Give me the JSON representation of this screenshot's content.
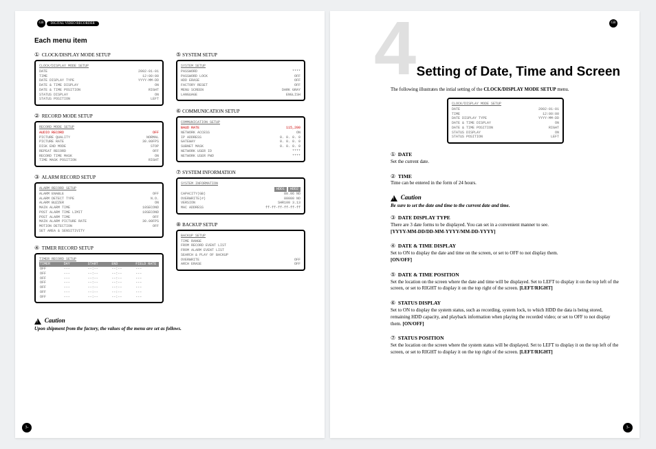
{
  "header": {
    "product": "DIGITAL VIDEO RECORDER",
    "lang": "GB"
  },
  "left": {
    "heading": "Each menu item",
    "items": [
      {
        "num": "①",
        "title": "CLOCK/DISPLAY MODE SETUP"
      },
      {
        "num": "②",
        "title": "RECORD MODE SETUP"
      },
      {
        "num": "③",
        "title": "ALARM RECORD SETUP"
      },
      {
        "num": "④",
        "title": "TIMER RECORD SETUP"
      },
      {
        "num": "⑤",
        "title": "SYSTEM SETUP"
      },
      {
        "num": "⑥",
        "title": "COMMUNICATION SETUP"
      },
      {
        "num": "⑦",
        "title": "SYSTEM INFORMATION"
      },
      {
        "num": "⑧",
        "title": "BACKUP SETUP"
      }
    ],
    "caution": {
      "label": "Caution",
      "text": "Upon shipment from the factory, the values of the menu are set as follows."
    },
    "monitors": {
      "clock": {
        "title": "CLOCK/DISPLAY MODE SETUP",
        "rows": [
          [
            "DATE",
            "2002-01-01"
          ],
          [
            "TIME",
            "12:00:00"
          ],
          [
            "DATE DISPLAY TYPE",
            "YYYY-MM-DD"
          ],
          [
            "DATE & TIME DISPLAY",
            "ON"
          ],
          [
            "DATE & TIME POSITION",
            "RIGHT"
          ],
          [
            "STATUS DISPLAY",
            "ON"
          ],
          [
            "STATUS POSITION",
            "LEFT"
          ]
        ]
      },
      "record": {
        "title": "RECORD MODE SETUP",
        "rows": [
          [
            "AUDIO RECORD",
            "OFF"
          ],
          [
            "PICTURE QUALITY",
            "NORMAL"
          ],
          [
            "PICTURE RATE",
            "30.00FPS"
          ],
          [
            "DISK END MODE",
            "STOP"
          ],
          [
            "REPEAT RECORD",
            "OFF"
          ],
          [
            "RECORD TIME MASK",
            "ON"
          ],
          [
            "TIME MASK POSITION",
            "RIGHT"
          ]
        ]
      },
      "alarm": {
        "title": "ALARM RECORD SETUP",
        "rows": [
          [
            "ALARM ENABLE",
            "OFF"
          ],
          [
            "ALARM DETECT TYPE",
            "N.O."
          ],
          [
            "ALARM BUZZER",
            "ON"
          ],
          [
            "MAIN ALARM TIME",
            "10SECOND"
          ],
          [
            "POST ALARM TIME LIMIT",
            "10SECOND"
          ],
          [
            "POST ALARM TIME",
            "OFF"
          ],
          [
            "MAIN ALARM PICTURE RATE",
            "30.00FPS"
          ],
          [
            "MOTION DETECTION",
            "OFF"
          ],
          [
            "SET AREA & SENSITIVITY",
            ""
          ]
        ]
      },
      "timer": {
        "title": "TIMER RECORD SETUP",
        "headers": [
          "TIMER",
          "DAY",
          "START",
          "END",
          "FIELD RATE"
        ],
        "rows": [
          [
            "OFF",
            "---",
            "--:--",
            "--:--",
            "---"
          ],
          [
            "OFF",
            "---",
            "--:--",
            "--:--",
            "---"
          ],
          [
            "OFF",
            "---",
            "--:--",
            "--:--",
            "---"
          ],
          [
            "OFF",
            "---",
            "--:--",
            "--:--",
            "---"
          ],
          [
            "OFF",
            "---",
            "--:--",
            "--:--",
            "---"
          ],
          [
            "OFF",
            "---",
            "--:--",
            "--:--",
            "---"
          ],
          [
            "OFF",
            "---",
            "--:--",
            "--:--",
            "---"
          ]
        ]
      },
      "system": {
        "title": "SYSTEM SETUP",
        "rows": [
          [
            "PASSWORD",
            "****"
          ],
          [
            "PASSWORD LOCK",
            "OFF"
          ],
          [
            "HDD ERASE",
            "OFF"
          ],
          [
            "FACTORY RESET",
            "OFF"
          ],
          [
            "MENU SCREEN",
            "DARK GRAY"
          ],
          [
            "LANGUAGE",
            "ENGLISH"
          ]
        ]
      },
      "comm": {
        "title": "COMMUNICATION SETUP",
        "rows": [
          [
            "BAUD RATE",
            "115,200"
          ],
          [
            "NETWORK ACCESS",
            "ON"
          ],
          [
            "IP ADDRESS",
            "0. 0. 0. 0"
          ],
          [
            "GATEWAY",
            "0. 0. 0. 0"
          ],
          [
            "SUBNET MASK",
            "0. 0. 0. 0"
          ],
          [
            "NETWORK USER ID",
            "****"
          ],
          [
            "NETWORK USER PWD",
            "****"
          ]
        ]
      },
      "sysinfo": {
        "title": "SYSTEM INFORMATION",
        "hdr": [
          "HDD1",
          "HDD2"
        ],
        "rows": [
          [
            "CAPACITY(GB)",
            "80.06  NO"
          ],
          [
            "OVERWRITE(#)",
            "00000  NO"
          ],
          [
            "VERSION",
            "SHR100 3.13"
          ],
          [
            "MAC ADDRESS",
            "ff-ff-ff-ff-ff-ff"
          ]
        ]
      },
      "backup": {
        "title": "BACKUP SETUP",
        "rows": [
          [
            "TIME RANGE",
            ""
          ],
          [
            "FROM RECORD EVENT LIST",
            ""
          ],
          [
            "FROM ALARM EVENT LIST",
            ""
          ],
          [
            "SEARCH & PLAY OF BACKUP",
            ""
          ],
          [
            "OVERWRITE",
            "OFF"
          ],
          [
            "ARCH ERASE",
            "OFF"
          ]
        ]
      }
    },
    "pagenum": "3-13"
  },
  "right": {
    "bignum": "4",
    "chapter_title": "Setting of Date, Time and Screen",
    "intro_pre": "The following illustrates the intial setting of the ",
    "intro_bold": "CLOCK/DISPLAY MODE SETUP",
    "intro_post": " menu.",
    "list": [
      {
        "num": "①",
        "title": "DATE",
        "body": "Set the current date."
      },
      {
        "num": "②",
        "title": "TIME",
        "body": "Time can be entered in the form of 24 hours."
      }
    ],
    "caution1": {
      "label": "Caution",
      "text": "Be sure to set the date and time to the current date and time."
    },
    "list2": [
      {
        "num": "③",
        "title": "DATE DISPLAY TYPE",
        "body": "There are 3 date forms to be displayed. You can set in a convenient manner to see.",
        "opt": "[YYYY-MM-DD/DD-MM-YYYY/MM-DD-YYYY]"
      },
      {
        "num": "④",
        "title": "DATE & TIME DISPLAY",
        "body": "Set to ON to display the date and time on the screen, or set to OFF to not display them.",
        "opt": "[ON/OFF]"
      },
      {
        "num": "⑤",
        "title": "DATE & TIME POSITION",
        "body": "Set the location on the screen where the date and time will be displayed. Set to LEFT to display it on the top left of the screen, or set to RIGHT to display it on the top right of the screen.",
        "opt": "[LEFT/RIGHT]"
      },
      {
        "num": "⑥",
        "title": "STATUS DISPLAY",
        "body": "Set to ON to display the system status, such as recording, system lock, to which HDD the data is being stored, remaining HDD capacity, and playback information when playing the recorded video; or set to OFF to not display them.",
        "opt": "[ON/OFF]"
      },
      {
        "num": "⑦",
        "title": "STATUS POSITION",
        "body": "Set the location on the screen where the system status will be displayed. Set to LEFT to display it on the top left of the screen, or set to RIGHT to display it on the top right of the screen.",
        "opt": "[LEFT/RIGHT]"
      }
    ],
    "pagenum": "3-14"
  }
}
